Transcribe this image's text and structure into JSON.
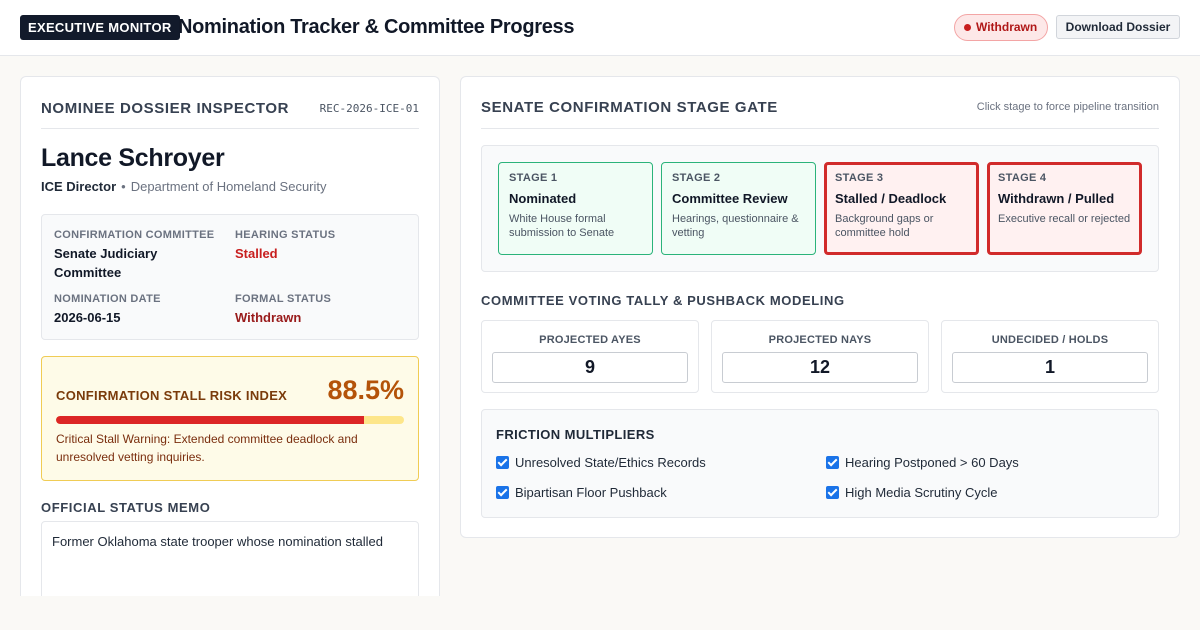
{
  "header": {
    "brand": "EXECUTIVE MONITOR",
    "title": "Nomination Tracker & Committee Progress",
    "status_pill": "Withdrawn",
    "download_label": "Download Dossier"
  },
  "dossier": {
    "panel_title": "NOMINEE DOSSIER INSPECTOR",
    "record_id": "REC-2026-ICE-01",
    "name": "Lance Schroyer",
    "role": "ICE Director",
    "separator": "•",
    "department": "Department of Homeland Security",
    "fields": {
      "committee_label": "CONFIRMATION COMMITTEE",
      "committee_value": "Senate Judiciary Committee",
      "hearing_label": "HEARING STATUS",
      "hearing_value": "Stalled",
      "date_label": "NOMINATION DATE",
      "date_value": "2026-06-15",
      "formal_label": "FORMAL STATUS",
      "formal_value": "Withdrawn"
    },
    "risk": {
      "title": "CONFIRMATION STALL RISK INDEX",
      "value_text": "88.5%",
      "percent": 88.5,
      "note": "Critical Stall Warning: Extended committee deadlock and unresolved vetting inquiries."
    },
    "memo_title": "OFFICIAL STATUS MEMO",
    "memo_text": "Former Oklahoma state trooper whose nomination stalled"
  },
  "pipeline": {
    "panel_title": "SENATE CONFIRMATION STAGE GATE",
    "hint": "Click stage to force pipeline transition",
    "stages": [
      {
        "num": "STAGE 1",
        "name": "Nominated",
        "desc": "White House formal submission to Senate",
        "state": "ok"
      },
      {
        "num": "STAGE 2",
        "name": "Committee Review",
        "desc": "Hearings, questionnaire & vetting",
        "state": "ok"
      },
      {
        "num": "STAGE 3",
        "name": "Stalled / Deadlock",
        "desc": "Background gaps or committee hold",
        "state": "bad"
      },
      {
        "num": "STAGE 4",
        "name": "Withdrawn / Pulled",
        "desc": "Executive recall or rejected",
        "state": "bad"
      }
    ]
  },
  "tally": {
    "title": "COMMITTEE VOTING TALLY & PUSHBACK MODELING",
    "ayes_label": "PROJECTED AYES",
    "ayes_value": "9",
    "nays_label": "PROJECTED NAYS",
    "nays_value": "12",
    "undecided_label": "UNDECIDED / HOLDS",
    "undecided_value": "1"
  },
  "friction": {
    "title": "FRICTION MULTIPLIERS",
    "items": [
      {
        "label": "Unresolved State/Ethics Records",
        "checked": true
      },
      {
        "label": "Hearing Postponed > 60 Days",
        "checked": true
      },
      {
        "label": "Bipartisan Floor Pushback",
        "checked": true
      },
      {
        "label": "High Media Scrutiny Cycle",
        "checked": true
      }
    ]
  },
  "colors": {
    "brand_bg": "#121a2b",
    "ok_stage": "#2bb37a",
    "bad_stage": "#d12b2b",
    "risk_fill": "#dc2626",
    "risk_track": "#fde68a",
    "check_blue": "#1a73e8"
  },
  "icons": {
    "status_dot": "status-dot-icon",
    "checkbox": "checkbox-checked-icon"
  }
}
